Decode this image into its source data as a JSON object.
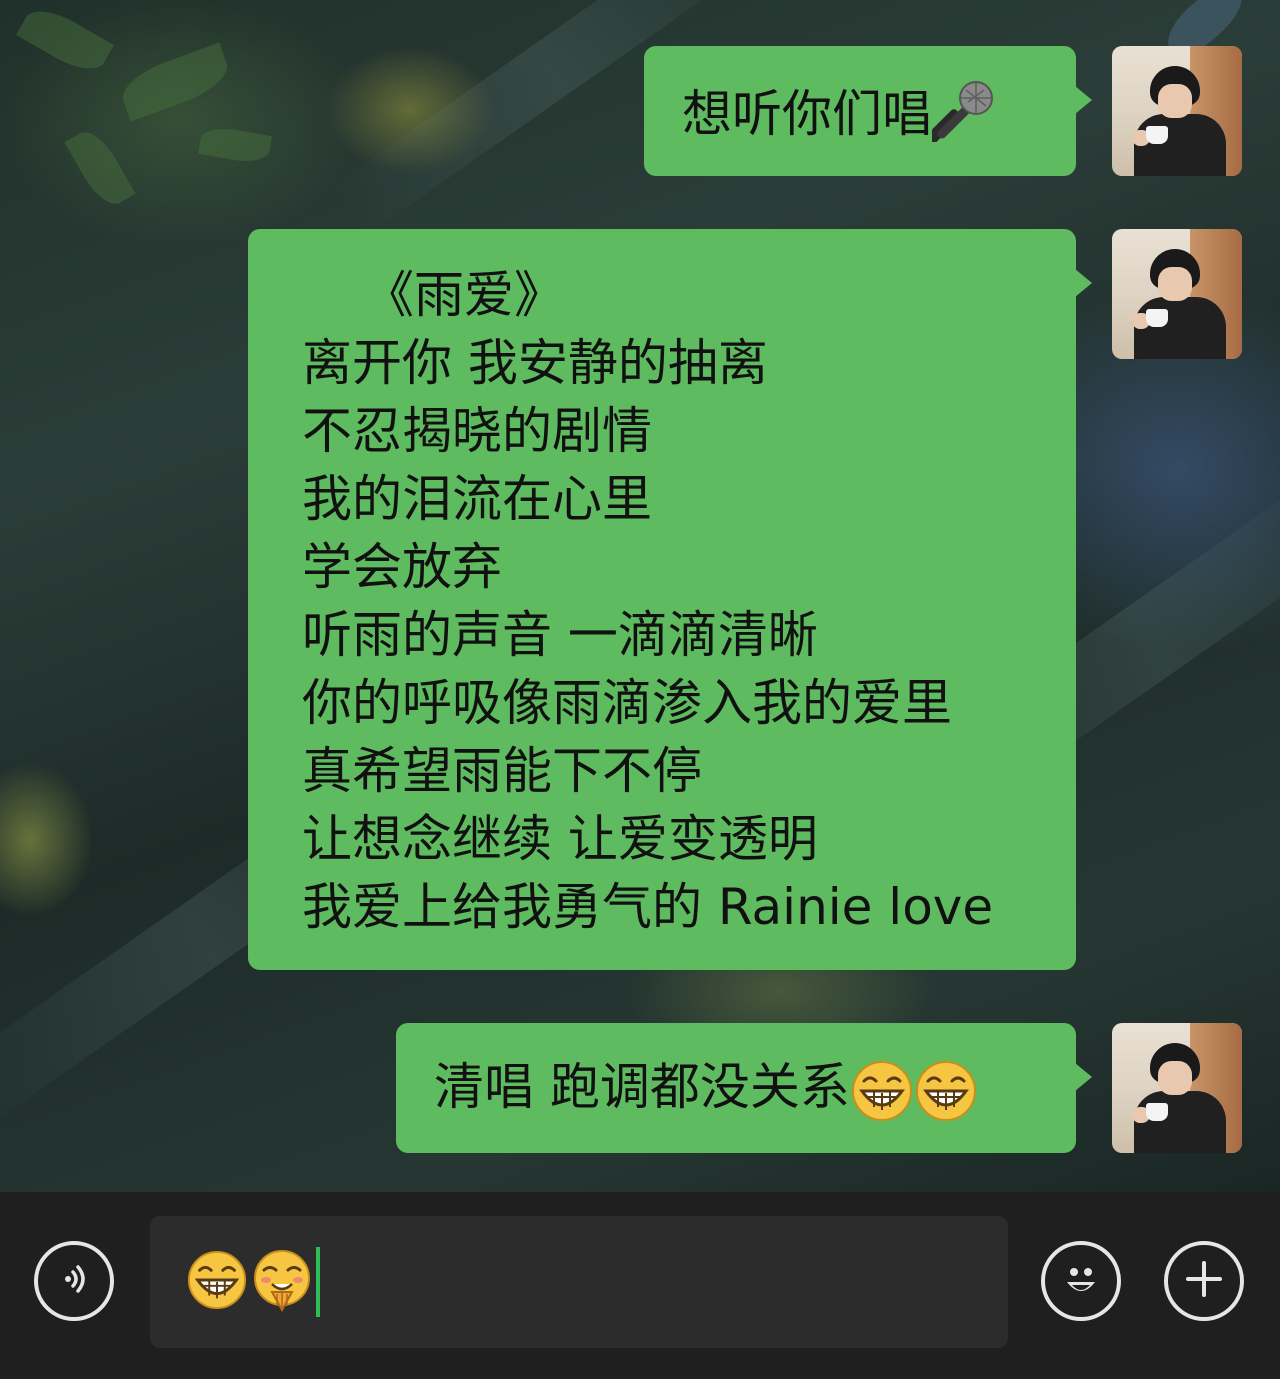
{
  "messages": [
    {
      "id": "m1",
      "text": "想听你们唱",
      "icon": "microphone-icon"
    },
    {
      "id": "m2",
      "title": "《雨爱》",
      "lines": [
        "离开你 我安静的抽离",
        "不忍揭晓的剧情",
        "我的泪流在心里",
        "学会放弃",
        "听雨的声音 一滴滴清晰",
        "你的呼吸像雨滴渗入我的爱里",
        "真希望雨能下不停",
        "让想念继续 让爱变透明",
        "我爱上给我勇气的 Rainie love"
      ]
    },
    {
      "id": "m3",
      "text": "清唱 跑调都没关系",
      "icons": [
        "grinning-face-icon",
        "grinning-face-icon"
      ]
    }
  ],
  "input": {
    "emojis": [
      "grinning-face-icon",
      "shy-face-icon"
    ]
  },
  "colors": {
    "bubble": "#5fbb60",
    "input_bar": "#1f1f1f",
    "input_field": "#2c2c2c",
    "caret": "#2fbe56"
  }
}
